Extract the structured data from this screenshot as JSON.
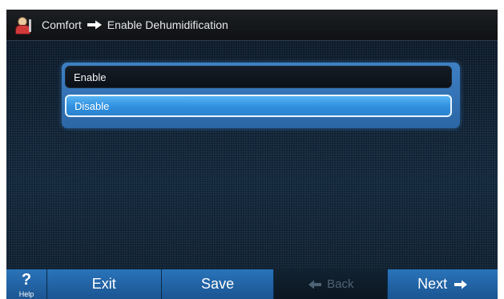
{
  "header": {
    "icon": "comfort-person-icon",
    "crumb_parent": "Comfort",
    "crumb_separator_icon": "right-arrow-icon",
    "crumb_current": "Enable Dehumidification"
  },
  "options": {
    "items": [
      {
        "label": "Enable",
        "selected": false
      },
      {
        "label": "Disable",
        "selected": true
      }
    ]
  },
  "nav": {
    "help_glyph": "?",
    "help_label": "Help",
    "exit_label": "Exit",
    "save_label": "Save",
    "back_label": "Back",
    "back_enabled": false,
    "next_label": "Next"
  },
  "colors": {
    "accent": "#2a73b9",
    "selected": "#3d9fe8",
    "background": "#0d1c2b"
  }
}
